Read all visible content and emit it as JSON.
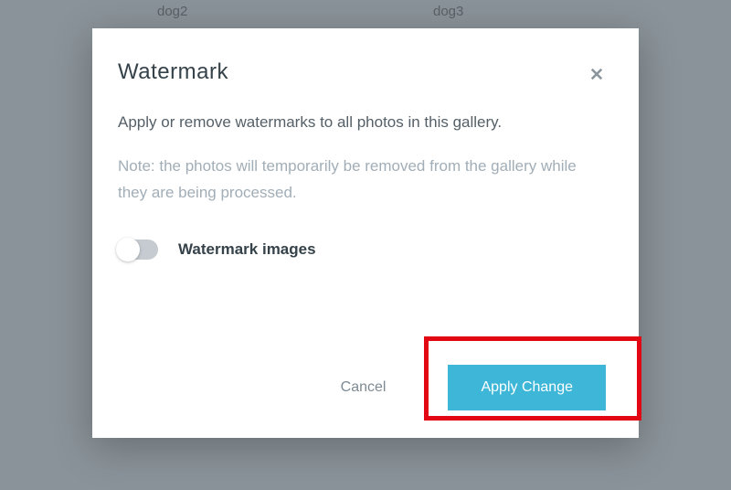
{
  "background": {
    "label1": "dog2",
    "label2": "dog3"
  },
  "modal": {
    "title": "Watermark",
    "description": "Apply or remove watermarks to all photos in this gallery.",
    "note": "Note: the photos will temporarily be removed from the gallery while they are being processed.",
    "toggle_label": "Watermark images",
    "cancel_label": "Cancel",
    "apply_label": "Apply Change"
  }
}
